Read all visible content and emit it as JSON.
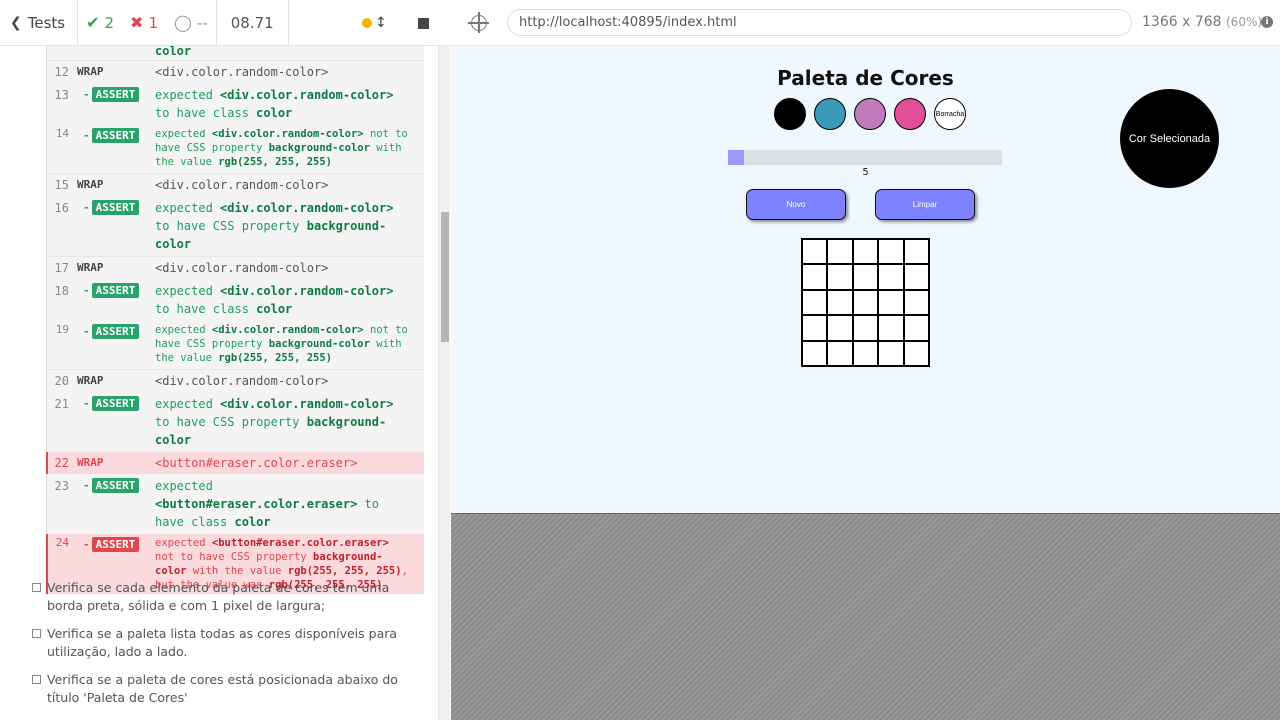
{
  "runner": {
    "tests_label": "Tests",
    "passed": "2",
    "failed": "1",
    "pending": "--",
    "time": "08.71"
  },
  "browser": {
    "url": "http://localhost:40895/index.html",
    "viewport_size": "1366 x 768",
    "viewport_scale": "(60%)"
  },
  "log": {
    "top_fragment": "color",
    "commands": [
      {
        "num": "12",
        "kind": "WRAP",
        "text": "<div.color.random-color>"
      },
      {
        "num": "13",
        "kind": "ASSERT",
        "pre": "expected ",
        "el": "<div.color.random-color>",
        "mid": " to have class ",
        "val": "color"
      },
      {
        "num": "14",
        "kind": "ASSERT",
        "pre": "expected ",
        "el": "<div.color.random-color>",
        "mid": " not to have CSS property ",
        "prop": "background-color",
        "mid2": " with the value ",
        "val": "rgb(255, 255, 255)"
      },
      {
        "num": "15",
        "kind": "WRAP",
        "text": "<div.color.random-color>"
      },
      {
        "num": "16",
        "kind": "ASSERT",
        "pre": "expected ",
        "el": "<div.color.random-color>",
        "mid": " to have CSS property ",
        "val": "background-color"
      },
      {
        "num": "17",
        "kind": "WRAP",
        "text": "<div.color.random-color>"
      },
      {
        "num": "18",
        "kind": "ASSERT",
        "pre": "expected ",
        "el": "<div.color.random-color>",
        "mid": " to have class ",
        "val": "color"
      },
      {
        "num": "19",
        "kind": "ASSERT",
        "pre": "expected ",
        "el": "<div.color.random-color>",
        "mid": " not to have CSS property ",
        "prop": "background-color",
        "mid2": " with the value ",
        "val": "rgb(255, 255, 255)"
      },
      {
        "num": "20",
        "kind": "WRAP",
        "text": "<div.color.random-color>"
      },
      {
        "num": "21",
        "kind": "ASSERT",
        "pre": "expected ",
        "el": "<div.color.random-color>",
        "mid": " to have CSS property ",
        "val": "background-color"
      },
      {
        "num": "22",
        "kind": "WRAP",
        "text": "<button#eraser.color.eraser>"
      },
      {
        "num": "23",
        "kind": "ASSERT",
        "pre": "expected ",
        "el": "<button#eraser.color.eraser>",
        "mid": " to have class ",
        "val": "color"
      },
      {
        "num": "24",
        "kind": "ASSERT",
        "pre": "expected ",
        "el": "<button#eraser.color.eraser>",
        "mid": " not to have CSS property ",
        "prop": "background-color",
        "mid2": " with the value ",
        "val": "rgb(255, 255, 255)",
        "mid3": ", but the value was ",
        "val2": "rgb(255, 255, 255)"
      }
    ],
    "tests": [
      "Verifica se cada elemento da paleta de cores tem uma borda preta, sólida e com 1 pixel de largura;",
      "Verifica se a paleta lista todas as cores disponíveis para utilização, lado a lado.",
      "Verifica se a paleta de cores está posicionada abaixo do título 'Paleta de Cores'"
    ]
  },
  "app": {
    "title": "Paleta de Cores",
    "palette_colors": [
      "#000000",
      "#3a9ab8",
      "#c07bbe",
      "#e04e98"
    ],
    "eraser_label": "Borracha",
    "size_value": 5,
    "size_min": 5,
    "size_max": 50,
    "new_button": "Novo",
    "clear_button": "Limpar",
    "board_size": 5,
    "selected_label": "Cor Selecionada",
    "selected_color": "#000000"
  }
}
